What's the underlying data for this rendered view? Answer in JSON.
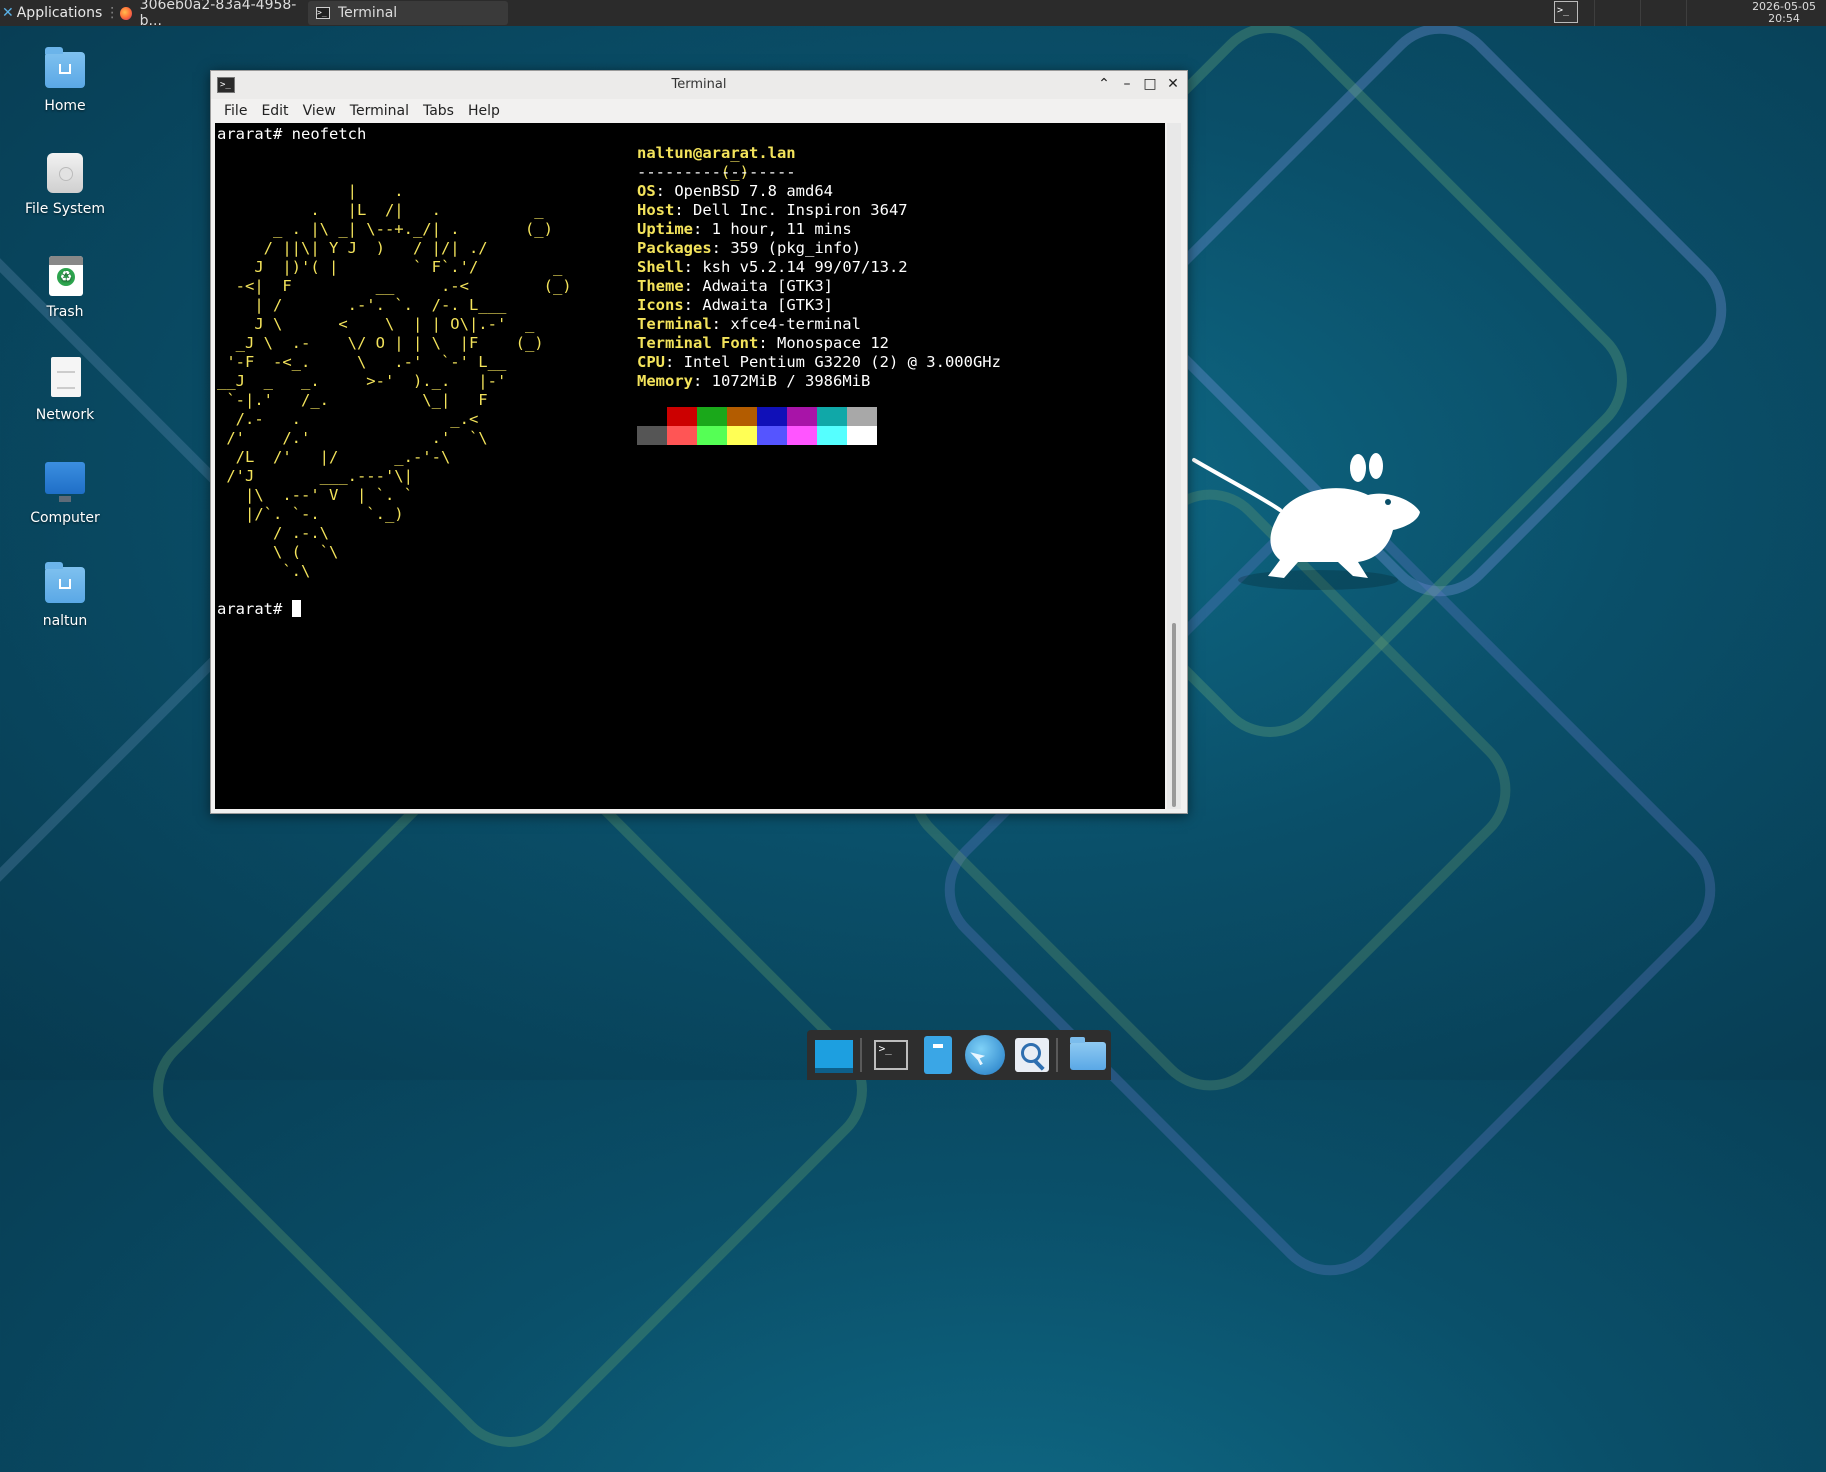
{
  "top_panel": {
    "apps_label": "Applications",
    "tasks": [
      {
        "label": "306eb0a2-83a4-4958-b..."
      },
      {
        "label": "Terminal"
      }
    ],
    "clock_date": "2026-05-05",
    "clock_time": "20:54"
  },
  "desktop_icons": [
    {
      "label": "Home",
      "icon": "home-folder-icon"
    },
    {
      "label": "File System",
      "icon": "drive-icon"
    },
    {
      "label": "Trash",
      "icon": "trash-icon"
    },
    {
      "label": "Network",
      "icon": "network-icon"
    },
    {
      "label": "Computer",
      "icon": "computer-icon"
    },
    {
      "label": "naltun",
      "icon": "home-folder-icon"
    }
  ],
  "window": {
    "title": "Terminal",
    "menu": [
      "File",
      "Edit",
      "View",
      "Terminal",
      "Tabs",
      "Help"
    ]
  },
  "terminal": {
    "command_line": "ararat# neofetch",
    "ascii_art_lines": [
      "                                                       _",
      "                                                      (_)",
      "              |    .",
      "          .   |L  /|   .          _",
      "      _ . |\\ _| \\--+._/| .       (_)",
      "     / ||\\| Y J  )   / |/| ./",
      "    J  |)'( |        ` F`.'/        _",
      "  -<|  F         __     .-<        (_)",
      "    | /       .-'. `.  /-. L___",
      "    J \\      <    \\  | | O\\|.-'  _",
      "  _J \\  .-    \\/ O | | \\  |F    (_)",
      " '-F  -<_.     \\   .-'  `-' L__",
      "__J  _   _.     >-'  )._.   |-'",
      " `-|.'   /_.          \\_|   F",
      "  /.-   .                _.<",
      " /'    /.'             .'  `\\",
      "  /L  /'   |/      _.-'-\\",
      " /'J       ___.---'\\|",
      "   |\\  .--' V  | `. `",
      "   |/`. `-.     `._)",
      "      / .-.\\",
      "      \\ (  `\\",
      "       `.\\"
    ],
    "user_host": "naltun@ararat.lan",
    "separator": "-----------------",
    "info": [
      {
        "key": "OS",
        "value": "OpenBSD 7.8 amd64"
      },
      {
        "key": "Host",
        "value": "Dell Inc. Inspiron 3647"
      },
      {
        "key": "Uptime",
        "value": "1 hour, 11 mins"
      },
      {
        "key": "Packages",
        "value": "359 (pkg_info)"
      },
      {
        "key": "Shell",
        "value": "ksh v5.2.14 99/07/13.2"
      },
      {
        "key": "Theme",
        "value": "Adwaita [GTK3]"
      },
      {
        "key": "Icons",
        "value": "Adwaita [GTK3]"
      },
      {
        "key": "Terminal",
        "value": "xfce4-terminal"
      },
      {
        "key": "Terminal Font",
        "value": "Monospace 12"
      },
      {
        "key": "CPU",
        "value": "Intel Pentium G3220 (2) @ 3.000GHz"
      },
      {
        "key": "Memory",
        "value": "1072MiB / 3986MiB"
      }
    ],
    "palette_top": [
      "#000000",
      "#cc0000",
      "#1aa81a",
      "#b35c00",
      "#1010b8",
      "#a814a8",
      "#10a8a8",
      "#a8a8a8"
    ],
    "palette_bottom": [
      "#555555",
      "#ff5555",
      "#55ff55",
      "#ffff55",
      "#5555ff",
      "#ff55ff",
      "#55ffff",
      "#ffffff"
    ],
    "prompt": "ararat# "
  },
  "dock": {
    "items": [
      "show-desktop-icon",
      "terminal-icon",
      "file-manager-icon",
      "web-browser-icon",
      "app-finder-icon",
      "folder-icon"
    ]
  },
  "colors": {
    "terminal_bg": "#000000",
    "ascii_yellow": "#f3e35b",
    "ascii_cyan": "#55e8ee",
    "panel_bg": "#2b2b2b"
  }
}
